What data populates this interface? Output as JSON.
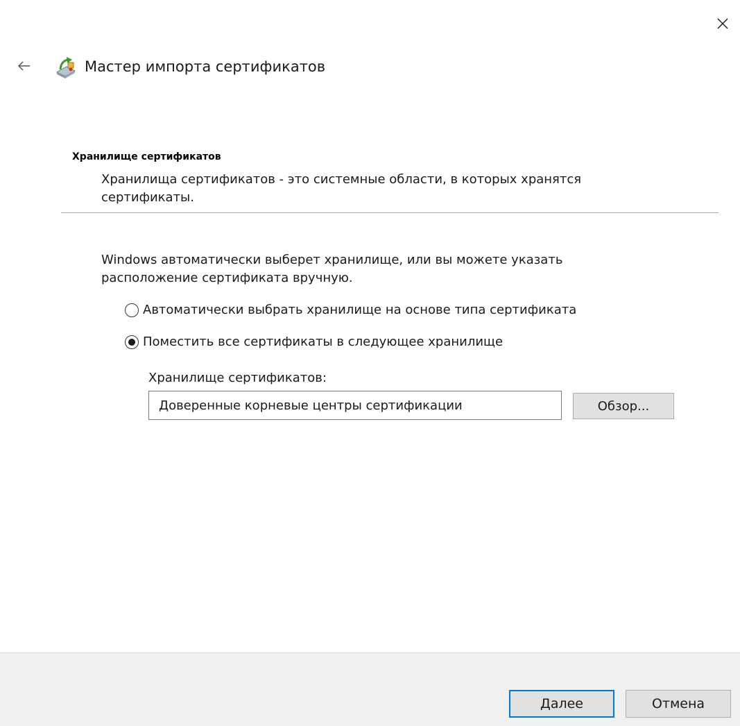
{
  "window": {
    "close_icon": "close-icon"
  },
  "header": {
    "back_icon": "back-arrow-icon",
    "wizard_icon": "certificate-wizard-icon",
    "title": "Мастер импорта сертификатов"
  },
  "section": {
    "title": "Хранилище сертификатов",
    "description": "Хранилища сертификатов - это системные области, в которых хранятся сертификаты."
  },
  "main": {
    "intro": "Windows автоматически выберет хранилище, или вы можете указать расположение сертификата вручную.",
    "options": [
      {
        "label": "Автоматически выбрать хранилище на основе типа сертификата",
        "selected": false
      },
      {
        "label": "Поместить все сертификаты в следующее хранилище",
        "selected": true
      }
    ],
    "store_label": "Хранилище сертификатов:",
    "store_value": "Доверенные корневые центры сертификации",
    "browse_label": "Обзор..."
  },
  "footer": {
    "next_label": "Далее",
    "cancel_label": "Отмена",
    "accent_color": "#0078d7"
  }
}
